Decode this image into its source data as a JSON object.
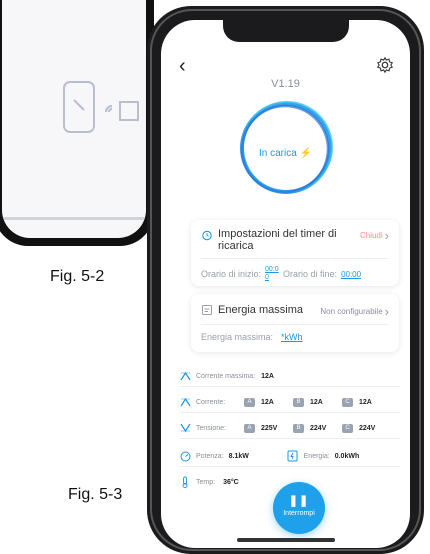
{
  "figures": {
    "fig2": "Fig. 5-2",
    "fig3": "Fig. 5-3"
  },
  "app": {
    "version": "V1.19",
    "status": "In carica",
    "timer": {
      "title": "Impostazioni del timer di ricarica",
      "state": "Chiudi",
      "start_label": "Orario di inizio:",
      "start_value": "00:0 0",
      "end_label": "Orario di fine:",
      "end_value": "00:00"
    },
    "max_energy": {
      "title": "Energia massima",
      "state": "Non configurabile",
      "row_label": "Energia massima:",
      "row_value": "*kWh"
    },
    "stats": {
      "max_current_label": "Corrente massima:",
      "max_current_value": "12A",
      "current_label": "Corrente:",
      "current": [
        {
          "phase": "A",
          "value": "12A"
        },
        {
          "phase": "B",
          "value": "12A"
        },
        {
          "phase": "C",
          "value": "12A"
        }
      ],
      "voltage_label": "Tensione:",
      "voltage": [
        {
          "phase": "A",
          "value": "225V"
        },
        {
          "phase": "B",
          "value": "224V"
        },
        {
          "phase": "C",
          "value": "224V"
        }
      ],
      "power_label": "Potenza:",
      "power_value": "8.1kW",
      "energy_label": "Energia:",
      "energy_value": "0.0kWh",
      "temp_label": "Temp:",
      "temp_value": "36°C"
    },
    "stop_button": "Interrompi"
  },
  "colors": {
    "accent": "#1e96e3",
    "closed": "#ff8b8b"
  }
}
